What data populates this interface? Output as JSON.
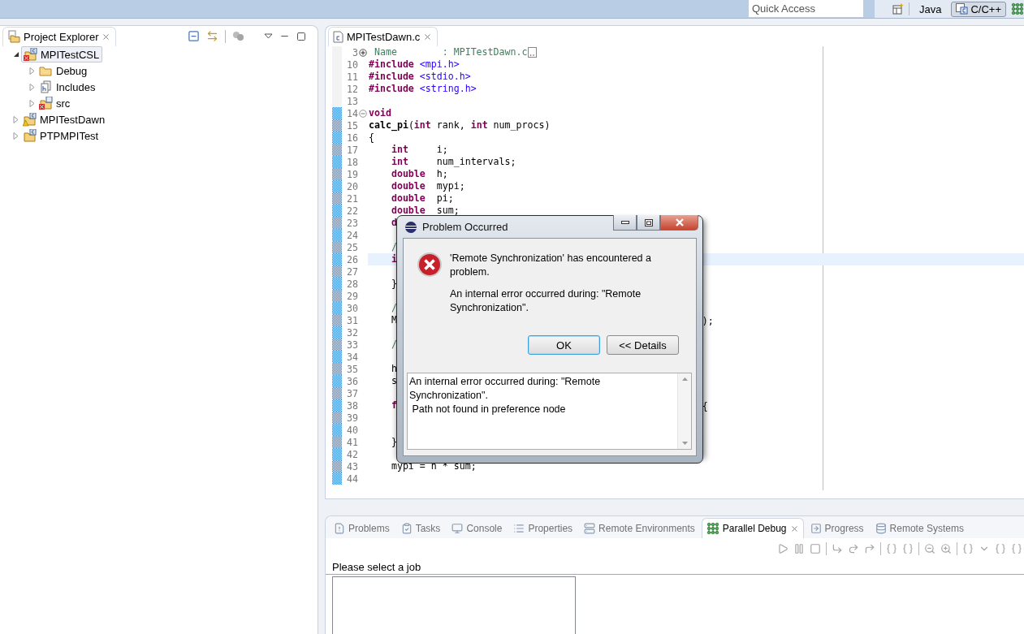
{
  "top_bar": {
    "quick_access": {
      "placeholder": "Quick Access"
    },
    "perspectives": [
      {
        "label": "Java",
        "selected": false
      },
      {
        "label": "C/C++",
        "selected": true
      }
    ]
  },
  "project_explorer": {
    "title": "Project Explorer",
    "tree": [
      {
        "label": "MPITestCSL",
        "kind": "project",
        "error": true,
        "warning": false,
        "expanded": true,
        "selected": true,
        "children": [
          {
            "label": "Debug",
            "kind": "folder",
            "error": false,
            "warning": false,
            "expanded": false,
            "selected": false
          },
          {
            "label": "Includes",
            "kind": "includes",
            "error": false,
            "warning": false,
            "expanded": false,
            "selected": false
          },
          {
            "label": "src",
            "kind": "source_folder",
            "error": true,
            "warning": false,
            "expanded": false,
            "selected": false
          }
        ]
      },
      {
        "label": "MPITestDawn",
        "kind": "project",
        "error": false,
        "warning": true,
        "expanded": false,
        "selected": false
      },
      {
        "label": "PTPMPITest",
        "kind": "project",
        "error": false,
        "warning": false,
        "expanded": false,
        "selected": false
      }
    ]
  },
  "editor": {
    "tab": "MPITestDawn.c",
    "lines": [
      {
        "n": "3",
        "folded": true,
        "code": [
          {
            "kind": "comment",
            "text": " Name        : MPITestDawn.c"
          }
        ],
        "in_range": false,
        "current": false
      },
      {
        "n": "10",
        "code": [
          {
            "kind": "keyword",
            "text": "#include"
          },
          {
            "kind": "string",
            "text": " <mpi.h>"
          }
        ],
        "in_range": false,
        "current": false
      },
      {
        "n": "11",
        "code": [
          {
            "kind": "keyword",
            "text": "#include"
          },
          {
            "kind": "string",
            "text": " <stdio.h>"
          }
        ],
        "in_range": false,
        "current": false
      },
      {
        "n": "12",
        "code": [
          {
            "kind": "keyword",
            "text": "#include"
          },
          {
            "kind": "string",
            "text": " <string.h>"
          }
        ],
        "in_range": false,
        "current": false
      },
      {
        "n": "13",
        "in_range": false,
        "current": false
      },
      {
        "n": "14",
        "folded": false,
        "code": [
          {
            "kind": "keyword",
            "text": "void"
          }
        ],
        "in_range": true,
        "current": false
      },
      {
        "n": "15",
        "code": [
          {
            "kind": "function",
            "text": "calc_pi"
          },
          {
            "kind": "plain",
            "text": "("
          },
          {
            "kind": "keyword",
            "text": "int"
          },
          {
            "kind": "plain",
            "text": " rank, "
          },
          {
            "kind": "keyword",
            "text": "int"
          },
          {
            "kind": "plain",
            "text": " num_procs)"
          }
        ],
        "in_range": true,
        "current": false
      },
      {
        "n": "16",
        "code": [
          {
            "kind": "plain",
            "text": "{"
          }
        ],
        "in_range": true,
        "current": false
      },
      {
        "n": "17",
        "code": [
          {
            "kind": "keyword",
            "text": "    int"
          },
          {
            "kind": "plain",
            "text": "     i;"
          }
        ],
        "in_range": true,
        "current": false
      },
      {
        "n": "18",
        "code": [
          {
            "kind": "keyword",
            "text": "    int"
          },
          {
            "kind": "plain",
            "text": "     num_intervals;"
          }
        ],
        "in_range": true,
        "current": false
      },
      {
        "n": "19",
        "code": [
          {
            "kind": "keyword",
            "text": "    double"
          },
          {
            "kind": "plain",
            "text": "  h;"
          }
        ],
        "in_range": true,
        "current": false
      },
      {
        "n": "20",
        "code": [
          {
            "kind": "keyword",
            "text": "    double"
          },
          {
            "kind": "plain",
            "text": "  mypi;"
          }
        ],
        "in_range": true,
        "current": false
      },
      {
        "n": "21",
        "code": [
          {
            "kind": "keyword",
            "text": "    double"
          },
          {
            "kind": "plain",
            "text": "  pi;"
          }
        ],
        "in_range": true,
        "current": false
      },
      {
        "n": "22",
        "code": [
          {
            "kind": "keyword",
            "text": "    double"
          },
          {
            "kind": "plain",
            "text": "  sum;"
          }
        ],
        "in_range": true,
        "current": false
      },
      {
        "n": "23",
        "code": [
          {
            "kind": "keyword",
            "text": "    d"
          }
        ],
        "in_range": true,
        "current": false
      },
      {
        "n": "24",
        "in_range": true,
        "current": false
      },
      {
        "n": "25",
        "code": [
          {
            "kind": "comment",
            "text": "    /"
          }
        ],
        "in_range": true,
        "current": false
      },
      {
        "n": "26",
        "code": [
          {
            "kind": "keyword",
            "text": "    i"
          }
        ],
        "in_range": true,
        "current": true
      },
      {
        "n": "27",
        "in_range": true,
        "current": false
      },
      {
        "n": "28",
        "code": [
          {
            "kind": "plain",
            "text": "    }"
          }
        ],
        "in_range": true,
        "current": false
      },
      {
        "n": "29",
        "in_range": true,
        "current": false
      },
      {
        "n": "30",
        "code": [
          {
            "kind": "comment",
            "text": "    /"
          }
        ],
        "in_range": true,
        "current": false
      },
      {
        "n": "31",
        "code": [
          {
            "kind": "plain",
            "text": "    M"
          }
        ],
        "tail": ");",
        "in_range": true,
        "current": false
      },
      {
        "n": "32",
        "in_range": true,
        "current": false
      },
      {
        "n": "33",
        "code": [
          {
            "kind": "comment",
            "text": "    /"
          }
        ],
        "in_range": true,
        "current": false
      },
      {
        "n": "34",
        "in_range": true,
        "current": false
      },
      {
        "n": "35",
        "code": [
          {
            "kind": "plain",
            "text": "    h"
          }
        ],
        "in_range": true,
        "current": false
      },
      {
        "n": "36",
        "code": [
          {
            "kind": "plain",
            "text": "    s"
          }
        ],
        "in_range": true,
        "current": false
      },
      {
        "n": "37",
        "in_range": true,
        "current": false
      },
      {
        "n": "38",
        "code": [
          {
            "kind": "keyword",
            "text": "    f"
          }
        ],
        "tail": "{",
        "in_range": true,
        "current": false
      },
      {
        "n": "39",
        "in_range": true,
        "current": false
      },
      {
        "n": "40",
        "in_range": true,
        "current": false
      },
      {
        "n": "41",
        "code": [
          {
            "kind": "plain",
            "text": "    }"
          }
        ],
        "in_range": true,
        "current": false
      },
      {
        "n": "42",
        "in_range": true,
        "current": false
      },
      {
        "n": "43",
        "code": [
          {
            "kind": "plain",
            "text": "    mypi = h * sum;"
          }
        ],
        "in_range": true,
        "current": false
      },
      {
        "n": "44",
        "in_range": true,
        "current": false
      }
    ]
  },
  "dialog": {
    "title": "Problem Occurred",
    "message": "'Remote Synchronization' has encountered a problem.",
    "detail": "An internal error occurred during: \"Remote Synchronization\".",
    "buttons": [
      {
        "label": "OK",
        "default": true
      },
      {
        "label": "<< Details",
        "default": false
      }
    ],
    "details_text": "An internal error occurred during: \"Remote Synchronization\".\n Path not found in preference node"
  },
  "bottom_panel": {
    "tabs": [
      {
        "label": "Problems",
        "selected": false
      },
      {
        "label": "Tasks",
        "selected": false
      },
      {
        "label": "Console",
        "selected": false
      },
      {
        "label": "Properties",
        "selected": false
      },
      {
        "label": "Remote Environments",
        "selected": false
      },
      {
        "label": "Parallel Debug",
        "selected": true
      },
      {
        "label": "Progress",
        "selected": false
      },
      {
        "label": "Remote Systems",
        "selected": false
      }
    ],
    "heading": "Please select a job"
  }
}
